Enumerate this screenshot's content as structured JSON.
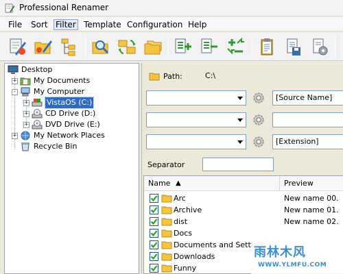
{
  "window": {
    "title": "Professional Renamer"
  },
  "menu": [
    "File",
    "Sort",
    "Filter",
    "Template",
    "Configuration",
    "Help"
  ],
  "menu_active": "Filter",
  "toolbar": {
    "buttons": [
      "rename-go-icon",
      "rename-folder-icon",
      "tree-structure-icon",
      "find-in-folder-icon",
      "refresh-folders-icon",
      "folders-icon",
      "add-file-icon",
      "remove-file-icon",
      "move-up-down-icon",
      "clipboard-icon",
      "save-file-icon",
      "settings-doc-icon"
    ]
  },
  "tree": {
    "items": [
      {
        "label": "Desktop",
        "icon": "desktop-icon",
        "level": 0,
        "expander": ""
      },
      {
        "label": "My Documents",
        "icon": "my-documents-icon",
        "level": 1,
        "expander": "+"
      },
      {
        "label": "My Computer",
        "icon": "computer-icon",
        "level": 1,
        "expander": "-"
      },
      {
        "label": "VistaOS (C:)",
        "icon": "hard-drive-icon",
        "level": 2,
        "expander": "+",
        "selected": true
      },
      {
        "label": "CD Drive (D:)",
        "icon": "cd-drive-icon",
        "level": 2,
        "expander": "+"
      },
      {
        "label": "DVD Drive (E:)",
        "icon": "dvd-drive-icon",
        "level": 2,
        "expander": "+"
      },
      {
        "label": "My Network Places",
        "icon": "network-icon",
        "level": 1,
        "expander": "+"
      },
      {
        "label": "Recycle Bin",
        "icon": "recycle-bin-icon",
        "level": 1,
        "expander": ""
      }
    ]
  },
  "path": {
    "label": "Path:",
    "value": "C:\\"
  },
  "filters": [
    {
      "combo_value": "",
      "field": "[Source Name]"
    },
    {
      "combo_value": "",
      "field": ""
    },
    {
      "combo_value": "",
      "field": "[Extension]"
    }
  ],
  "separator": {
    "label": "Separator",
    "value": ""
  },
  "list": {
    "columns": {
      "name": "Name",
      "preview": "Preview"
    },
    "rows": [
      {
        "name": "Arc",
        "preview": "New name 00.",
        "checked": true
      },
      {
        "name": "Archive",
        "preview": "New name 01.",
        "checked": true
      },
      {
        "name": "dist",
        "preview": "New name 02.",
        "checked": true
      },
      {
        "name": "Docs",
        "preview": "",
        "checked": true
      },
      {
        "name": "Documents and Settings",
        "preview": "",
        "checked": true
      },
      {
        "name": "Downloads",
        "preview": "",
        "checked": true
      },
      {
        "name": "Funny",
        "preview": "",
        "checked": true
      }
    ]
  },
  "watermark": {
    "brand": "雨林木风",
    "url": "WWW.YLMFU.COM"
  },
  "colors": {
    "selection": "#316ac5",
    "folder": "#f5c542",
    "check": "#21a121",
    "accent_green": "#2d9a2d",
    "watermark": "#3a8fcf"
  }
}
